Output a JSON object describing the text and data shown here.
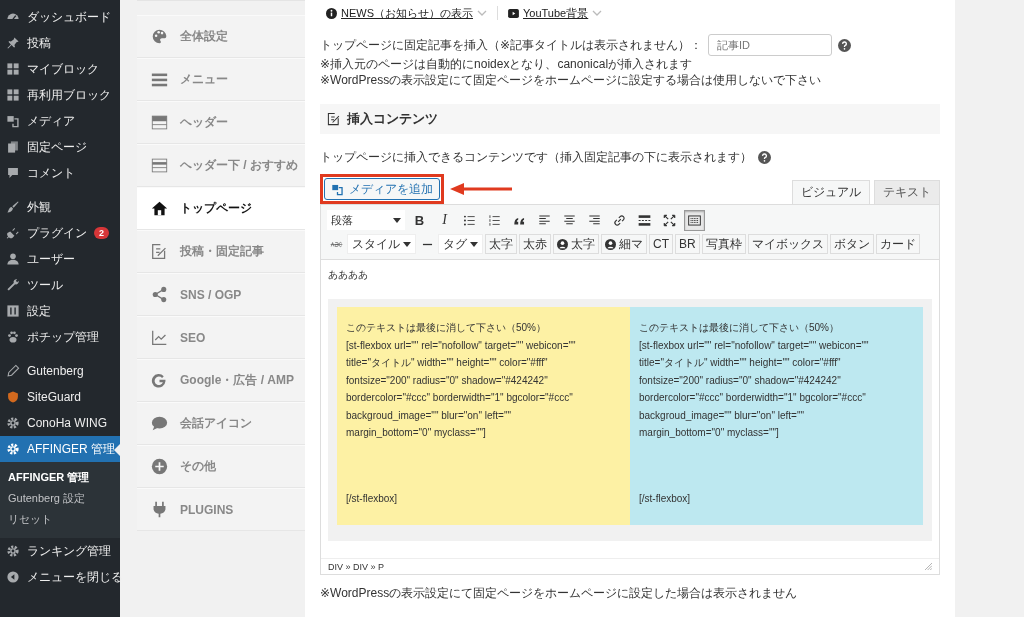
{
  "admin_menu": {
    "groups": [
      [
        {
          "label": "ダッシュボード",
          "selected": false
        },
        {
          "label": "投稿",
          "selected": false
        },
        {
          "label": "マイブロック",
          "selected": false
        },
        {
          "label": "再利用ブロック",
          "selected": false
        },
        {
          "label": "メディア",
          "selected": false
        },
        {
          "label": "固定ページ",
          "selected": false
        },
        {
          "label": "コメント",
          "selected": false
        }
      ],
      [
        {
          "label": "外観",
          "selected": false
        },
        {
          "label": "プラグイン",
          "selected": false,
          "badge": "2"
        },
        {
          "label": "ユーザー",
          "selected": false
        },
        {
          "label": "ツール",
          "selected": false
        },
        {
          "label": "設定",
          "selected": false
        },
        {
          "label": "ポチップ管理",
          "selected": false
        }
      ],
      [
        {
          "label": "Gutenberg",
          "selected": false
        },
        {
          "label": "SiteGuard",
          "selected": false
        },
        {
          "label": "ConoHa WING",
          "selected": false
        },
        {
          "label": "AFFINGER 管理",
          "selected": true,
          "submenu": [
            {
              "label": "AFFINGER 管理",
              "selected": true
            },
            {
              "label": "Gutenberg 設定",
              "selected": false
            },
            {
              "label": "リセット",
              "selected": false
            }
          ]
        },
        {
          "label": "ランキング管理",
          "selected": false
        },
        {
          "label": "メニューを閉じる",
          "selected": false
        }
      ]
    ]
  },
  "settings_nav": {
    "items": [
      {
        "label": "全体設定",
        "selected": false
      },
      {
        "label": "メニュー",
        "selected": false
      },
      {
        "label": "ヘッダー",
        "selected": false
      },
      {
        "label": "ヘッダー下 / おすすめ",
        "selected": false
      },
      {
        "label": "トップページ",
        "selected": true
      },
      {
        "label": "投稿・固定記事",
        "selected": false
      },
      {
        "label": "SNS / OGP",
        "selected": false
      },
      {
        "label": "SEO",
        "selected": false
      },
      {
        "label": "Google・広告 / AMP",
        "selected": false
      },
      {
        "label": "会話アイコン",
        "selected": false
      },
      {
        "label": "その他",
        "selected": false
      },
      {
        "label": "PLUGINS",
        "selected": false
      }
    ]
  },
  "top_links": [
    {
      "label": "NEWS（お知らせ）の表示"
    },
    {
      "label": "YouTube背景"
    }
  ],
  "insert_post": {
    "label": "トップページに固定記事を挿入（※記事タイトルは表示されません）：",
    "placeholder": "記事ID",
    "notes": [
      "※挿入元のページは自動的にnoidexとなり、canonicalが挿入されます",
      "※WordPressの表示設定にて固定ページをホームページに設定する場合は使用しないで下さい"
    ]
  },
  "section": {
    "title": "挿入コンテンツ"
  },
  "description": "トップページに挿入できるコンテンツです（挿入固定記事の下に表示されます）",
  "media_button": {
    "label": "メディアを追加"
  },
  "editor_tabs": [
    {
      "label": "ビジュアル",
      "selected": true
    },
    {
      "label": "テキスト",
      "selected": false
    }
  ],
  "toolbar_row1": {
    "format": "段落",
    "buttons": [
      {
        "kind": "bold",
        "label": "B",
        "pressed": false
      },
      {
        "kind": "italic",
        "label": "I",
        "pressed": false
      },
      {
        "kind": "bullet-list",
        "pressed": false
      },
      {
        "kind": "numbered-list",
        "pressed": false
      },
      {
        "kind": "quote",
        "pressed": false
      },
      {
        "kind": "align-left",
        "pressed": false
      },
      {
        "kind": "align-center",
        "pressed": false
      },
      {
        "kind": "align-right",
        "pressed": false
      },
      {
        "kind": "link",
        "pressed": false
      },
      {
        "kind": "more",
        "pressed": false
      },
      {
        "kind": "fullscreen",
        "pressed": false
      },
      {
        "kind": "toolbar-toggle",
        "pressed": true
      }
    ]
  },
  "toolbar_row2": [
    {
      "kind": "strikethrough"
    },
    {
      "kind": "dropdown",
      "label": "スタイル"
    },
    {
      "kind": "hr"
    },
    {
      "kind": "dropdown",
      "label": "タグ"
    },
    {
      "kind": "text",
      "label": "太字"
    },
    {
      "kind": "text",
      "label": "太赤"
    },
    {
      "kind": "user-text",
      "label": "太字"
    },
    {
      "kind": "user-text",
      "label": "細マ"
    },
    {
      "kind": "text",
      "label": "CT"
    },
    {
      "kind": "text",
      "label": "BR"
    },
    {
      "kind": "text",
      "label": "写真枠"
    },
    {
      "kind": "text",
      "label": "マイボックス"
    },
    {
      "kind": "text",
      "label": "ボタン"
    },
    {
      "kind": "text",
      "label": "カード"
    }
  ],
  "content": {
    "paragraph": "ああああ",
    "columns": [
      {
        "color": "#fdf1a4",
        "heading": "このテキストは最後に消して下さい（50%）",
        "lines": [
          "[st-flexbox url=\"\" rel=\"nofollow\" target=\"\" webicon=\"\"",
          "title=\"タイトル\" width=\"\" height=\"\" color=\"#fff\"",
          "fontsize=\"200\" radius=\"0\" shadow=\"#424242\"",
          "bordercolor=\"#ccc\" borderwidth=\"1\" bgcolor=\"#ccc\"",
          "backgroud_image=\"\" blur=\"on\" left=\"\"",
          "margin_bottom=\"0\" myclass=\"\"]"
        ],
        "closing": "[/st-flexbox]"
      },
      {
        "color": "#bde8f0",
        "heading": "このテキストは最後に消して下さい（50%）",
        "lines": [
          "[st-flexbox url=\"\" rel=\"nofollow\" target=\"\" webicon=\"\"",
          "title=\"タイトル\" width=\"\" height=\"\" color=\"#fff\"",
          "fontsize=\"200\" radius=\"0\" shadow=\"#424242\"",
          "bordercolor=\"#ccc\" borderwidth=\"1\" bgcolor=\"#ccc\"",
          "backgroud_image=\"\" blur=\"on\" left=\"\"",
          "margin_bottom=\"0\" myclass=\"\"]"
        ],
        "closing": "[/st-flexbox]"
      }
    ]
  },
  "status_path": "DIV » DIV » P",
  "footer_note": "※WordPressの表示設定にて固定ページをホームページに設定した場合は表示されません"
}
